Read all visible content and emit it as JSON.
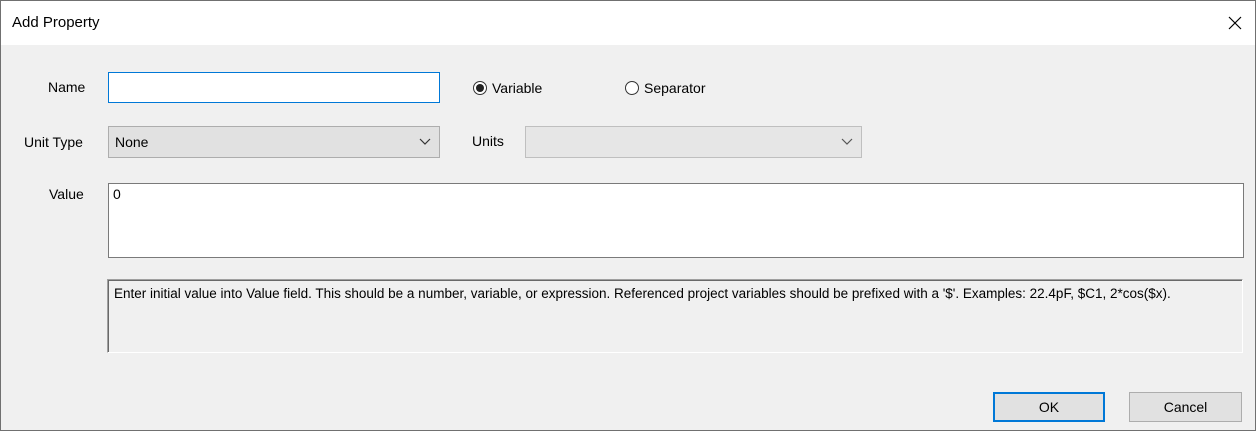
{
  "window": {
    "title": "Add Property",
    "close_icon": "close-icon"
  },
  "form": {
    "name_label": "Name",
    "name_value": "",
    "radio_variable_label": "Variable",
    "radio_variable_selected": true,
    "radio_separator_label": "Separator",
    "radio_separator_selected": false,
    "unit_type_label": "Unit Type",
    "unit_type_value": "None",
    "units_label": "Units",
    "units_value": "",
    "value_label": "Value",
    "value_value": "0",
    "hint_text": "Enter initial value into Value field. This should be a number, variable, or expression. Referenced project variables should be prefixed with a '$'. Examples: 22.4pF, $C1, 2*cos($x)."
  },
  "buttons": {
    "ok_label": "OK",
    "cancel_label": "Cancel"
  },
  "colors": {
    "focus_accent": "#0078d7",
    "dialog_bg": "#f0f0f0"
  }
}
